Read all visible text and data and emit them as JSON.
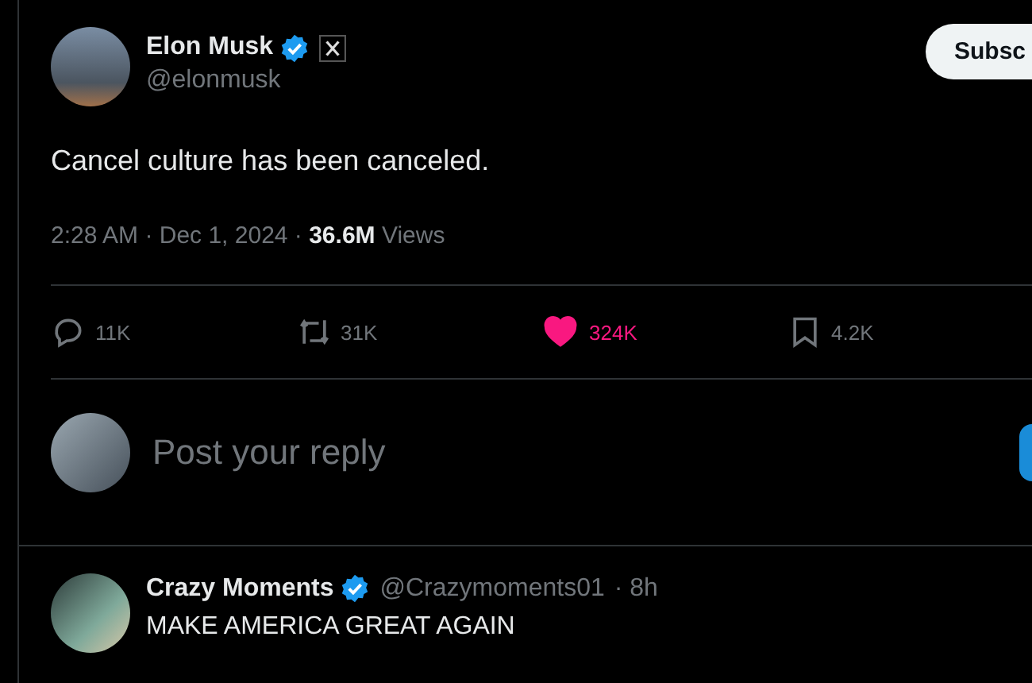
{
  "post": {
    "author": {
      "name": "Elon Musk",
      "handle": "@elonmusk",
      "verified": true,
      "affiliate_badge": true
    },
    "subscribe_button": "Subsc",
    "text": "Cancel culture has been canceled.",
    "meta": "2:28 AM · Dec 1, 2024 · **36.6M** Views",
    "actions": [
      {
        "kind": "reply",
        "count": "11K",
        "selected": false
      },
      {
        "kind": "repost",
        "count": "31K",
        "selected": false
      },
      {
        "kind": "like",
        "count": "324K",
        "selected": true
      },
      {
        "kind": "bookmark",
        "count": "4.2K",
        "selected": false
      }
    ]
  },
  "composer": {
    "placeholder": "Post your reply"
  },
  "replies": [
    {
      "name": "Crazy Moments",
      "verified": true,
      "handle": "@Crazymoments01",
      "time": "· 8h",
      "text": "MAKE AMERICA GREAT AGAIN"
    }
  ]
}
